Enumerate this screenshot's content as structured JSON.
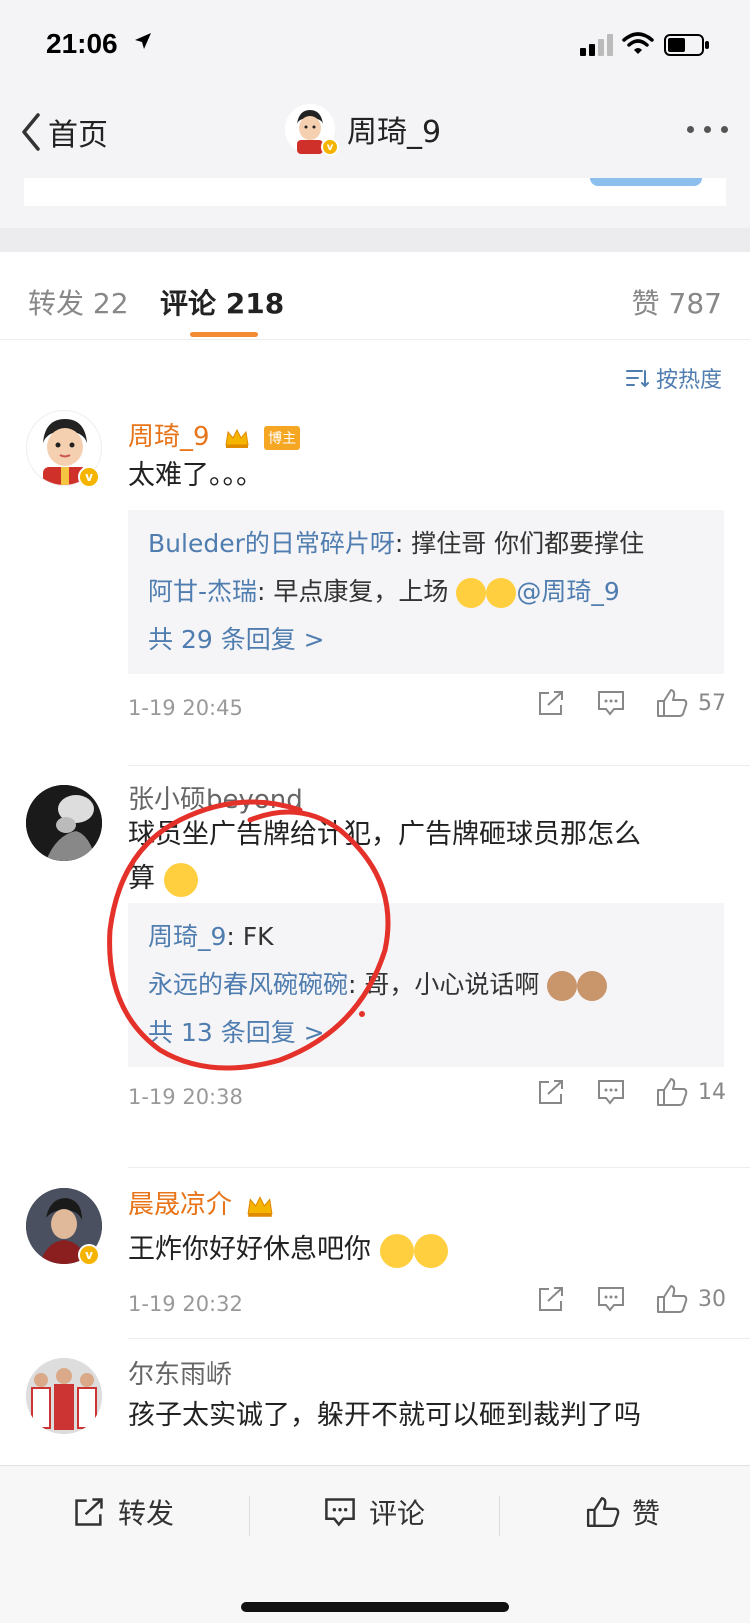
{
  "status_bar": {
    "time": "21:06"
  },
  "nav": {
    "back_label": "首页",
    "title": "周琦_9"
  },
  "tabs": [
    {
      "label": "转发 22"
    },
    {
      "label": "评论 218"
    },
    {
      "label": "赞 787"
    }
  ],
  "sort_label": "按热度",
  "comments": [
    {
      "user": "周琦_9",
      "author_tag": "博主",
      "text": "太难了。。。",
      "replies": [
        {
          "user": "Buleder的日常碎片呀",
          "text": ": 撑住哥 你们都要撑住"
        },
        {
          "user": "阿甘-杰瑞",
          "text": ": 早点康复，上场",
          "mention": "@周琦_9"
        }
      ],
      "more": "共 29 条回复 >",
      "time": "1-19 20:45",
      "likes": "57"
    },
    {
      "user": "张小硕beyond",
      "text_line1": "球员坐广告牌给计犯，广告牌砸球员那怎么",
      "text_line2": "算",
      "replies": [
        {
          "user": "周琦_9",
          "text": ": FK"
        },
        {
          "user": "永远的春风碗碗碗",
          "text": ": 哥，小心说话啊"
        }
      ],
      "more": "共 13 条回复 >",
      "time": "1-19 20:38",
      "likes": "14"
    },
    {
      "user": "晨晟凉介",
      "text": "王炸你好好休息吧你",
      "time": "1-19 20:32",
      "likes": "30"
    },
    {
      "user": "尔东雨峤",
      "text": "孩子太实诚了，躲开不就可以砸到裁判了吗"
    }
  ],
  "bottom_bar": {
    "repost": "转发",
    "comment": "评论",
    "like": "赞"
  }
}
